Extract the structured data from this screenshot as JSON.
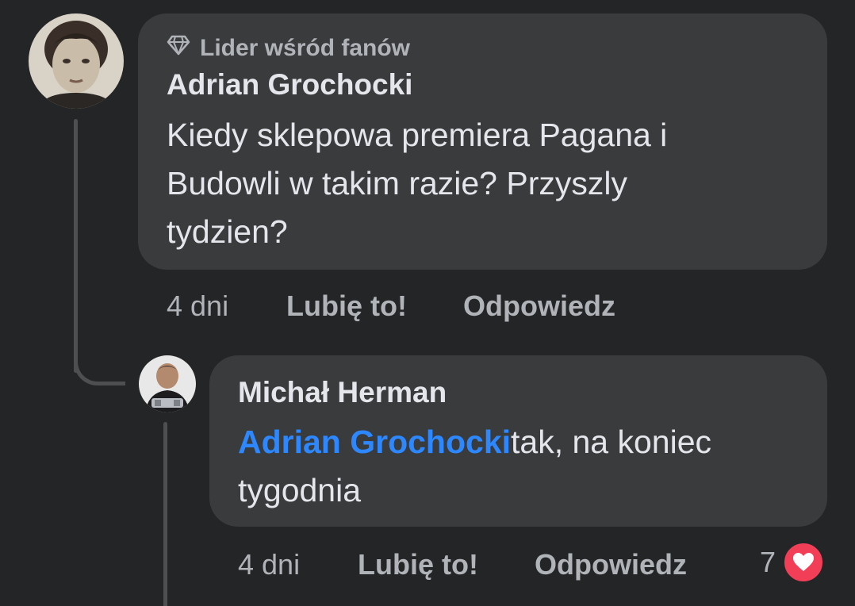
{
  "comment": {
    "badge_label": "Lider wśród fanów",
    "author": "Adrian Grochocki",
    "text_lines": [
      "Kiedy sklepowa premiera Pagana i",
      "Budowli w takim razie? Przyszly",
      "tydzien?"
    ],
    "time": "4 dni",
    "like_label": "Lubię to!",
    "reply_label": "Odpowiedz"
  },
  "reply": {
    "author": "Michał Herman",
    "mention": "Adrian Grochocki",
    "text_after_mention": "tak, na koniec",
    "text_line2": "tygodnia",
    "time": "4 dni",
    "like_label": "Lubię to!",
    "reply_label": "Odpowiedz",
    "reaction_count": "7"
  },
  "colors": {
    "background": "#242526",
    "bubble": "#3a3b3c",
    "mention": "#2d88ff",
    "heart": "#f33e58"
  }
}
